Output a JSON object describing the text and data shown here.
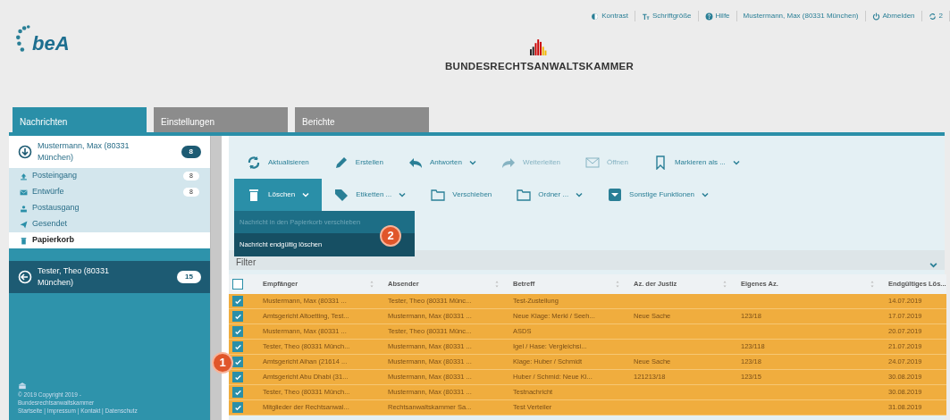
{
  "top_links": [
    {
      "label": "Kontrast"
    },
    {
      "label": "Schriftgröße"
    },
    {
      "label": "Hilfe"
    },
    {
      "label": "Mustermann, Max (80331 München)"
    },
    {
      "label": "Abmelden"
    },
    {
      "label": "2"
    }
  ],
  "logo": {
    "text": "beA"
  },
  "org_name": "BUNDESRECHTSANWALTSKAMMER",
  "tabs": [
    {
      "label": "Nachrichten",
      "selected": true
    },
    {
      "label": "Einstellungen",
      "selected": false
    },
    {
      "label": "Berichte",
      "selected": false
    }
  ],
  "sidebar": {
    "accounts": [
      {
        "name": "Mustermann, Max (80331 München)",
        "count": "8",
        "expanded": true,
        "folders": [
          {
            "label": "Posteingang",
            "count": "8",
            "selected": false
          },
          {
            "label": "Entwürfe",
            "count": "8",
            "selected": false
          },
          {
            "label": "Postausgang",
            "selected": false
          },
          {
            "label": "Gesendet",
            "selected": false
          },
          {
            "label": "Papierkorb",
            "selected": true
          }
        ]
      },
      {
        "name": "Tester, Theo (80331 München)",
        "count": "15",
        "expanded": false
      }
    ],
    "footer": [
      "© 2019 Copyright 2019 -",
      "Bundesrechtsanwaltskammer",
      "Startseite | Impressum | Kontakt | Datenschutz"
    ]
  },
  "toolbar": [
    [
      {
        "label": "Aktualisieren",
        "dropdown": false,
        "disabled": false,
        "selected": false
      },
      {
        "label": "Erstellen",
        "dropdown": false,
        "disabled": false,
        "selected": false
      },
      {
        "label": "Antworten",
        "dropdown": true,
        "disabled": false,
        "selected": false
      },
      {
        "label": "Weiterleiten",
        "dropdown": false,
        "disabled": true,
        "selected": false
      },
      {
        "label": "Öffnen",
        "dropdown": false,
        "disabled": true,
        "selected": false
      },
      {
        "label": "Markieren als ...",
        "dropdown": true,
        "disabled": false,
        "selected": false
      }
    ],
    [
      {
        "label": "Löschen",
        "dropdown": true,
        "disabled": false,
        "selected": true
      },
      {
        "label": "Etiketten ...",
        "dropdown": true,
        "disabled": false,
        "selected": false
      },
      {
        "label": "Verschieben",
        "dropdown": false,
        "disabled": false,
        "selected": false
      },
      {
        "label": "Ordner ...",
        "dropdown": true,
        "disabled": false,
        "selected": false
      },
      {
        "label": "Sonstige Funktionen",
        "dropdown": true,
        "disabled": false,
        "selected": false
      }
    ]
  ],
  "delete_menu": [
    {
      "label": "Nachricht in den Papierkorb verschieben",
      "disabled": true,
      "selected": false
    },
    {
      "label": "Nachricht endgültig löschen",
      "disabled": false,
      "selected": true
    }
  ],
  "filter": {
    "label": "Filter",
    "expanded": false
  },
  "table": {
    "all_checked": false,
    "columns": [
      "Empfänger",
      "Absender",
      "Betreff",
      "Az. der Justiz",
      "Eigenes Az.",
      "Endgültiges Lös..."
    ],
    "rows": [
      {
        "checked": true,
        "cells": [
          "Mustermann, Max (80331 ...",
          "Tester, Theo (80331 Münc...",
          "Test-Zustellung",
          "",
          "",
          "14.07.2019"
        ]
      },
      {
        "checked": true,
        "cells": [
          "Amtsgericht Altoetting, Test...",
          "Mustermann, Max (80331 ...",
          "Neue Klage: Merkl / Seeh...",
          "Neue Sache",
          "123/18",
          "17.07.2019"
        ]
      },
      {
        "checked": true,
        "cells": [
          "Mustermann, Max (80331 ...",
          "Tester, Theo (80331 Münc...",
          "ASDS",
          "",
          "",
          "20.07.2019"
        ]
      },
      {
        "checked": true,
        "cells": [
          "Tester, Theo (80331 Münch...",
          "Mustermann, Max (80331 ...",
          "Igel / Hase: Vergleichsi...",
          "",
          "123/118",
          "21.07.2019"
        ]
      },
      {
        "checked": true,
        "cells": [
          "Amtsgericht Aihan (21614 ...",
          "Mustermann, Max (80331 ...",
          "Klage: Huber / Schmidt",
          "Neue Sache",
          "123/18",
          "24.07.2019"
        ]
      },
      {
        "checked": true,
        "cells": [
          "Amtsgericht Abu Dhabi (31...",
          "Mustermann, Max (80331 ...",
          "Huber / Schmid: Neue Kl...",
          "121213/18",
          "123/15",
          "30.08.2019"
        ]
      },
      {
        "checked": true,
        "cells": [
          "Tester, Theo (80331 Münch...",
          "Mustermann, Max (80331 ...",
          "Testnachricht",
          "",
          "",
          "30.08.2019"
        ]
      },
      {
        "checked": true,
        "cells": [
          "Mitglieder der Rechtsanwal...",
          "Rechtsanwaltskammer Sa...",
          "Test Verteiler",
          "",
          "",
          "31.08.2019"
        ]
      }
    ]
  },
  "callouts": [
    "1",
    "2"
  ]
}
